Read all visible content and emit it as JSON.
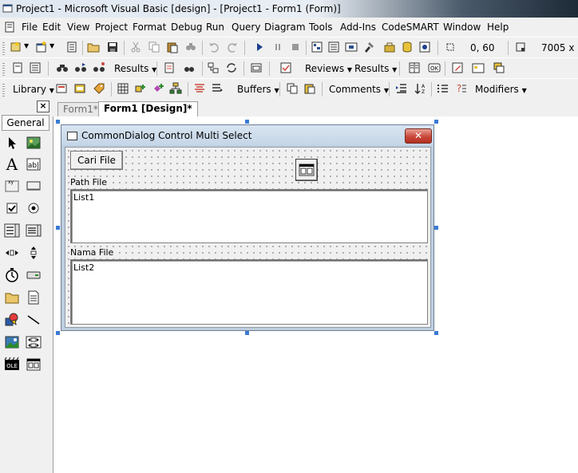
{
  "window": {
    "title": "Project1 - Microsoft Visual Basic [design] - [Project1 - Form1 (Form)]"
  },
  "menu": [
    "File",
    "Edit",
    "View",
    "Project",
    "Format",
    "Debug",
    "Run",
    "Query",
    "Diagram",
    "Tools",
    "Add-Ins",
    "CodeSMART",
    "Window",
    "Help"
  ],
  "toolbar1": {
    "position": "0, 60",
    "size": "7005 x 38"
  },
  "toolbar2": {
    "results1": "Results",
    "reviews": "Reviews",
    "results2": "Results"
  },
  "toolbar3": {
    "library": "Library",
    "buffers": "Buffers",
    "comments": "Comments",
    "modifiers": "Modifiers"
  },
  "toolbox": {
    "close": "×",
    "group": "General"
  },
  "tabs": [
    {
      "label": "Form1*"
    },
    {
      "label": "Form1 [Design]*"
    }
  ],
  "form": {
    "title": "CommonDialog Control Multi Select",
    "close": "✕",
    "button": "Cari File",
    "label_path": "Path File",
    "list1": "List1",
    "label_name": "Nama File",
    "list2": "List2"
  },
  "colors": {
    "accent": "#3a7bd5",
    "close": "#c9483a"
  }
}
